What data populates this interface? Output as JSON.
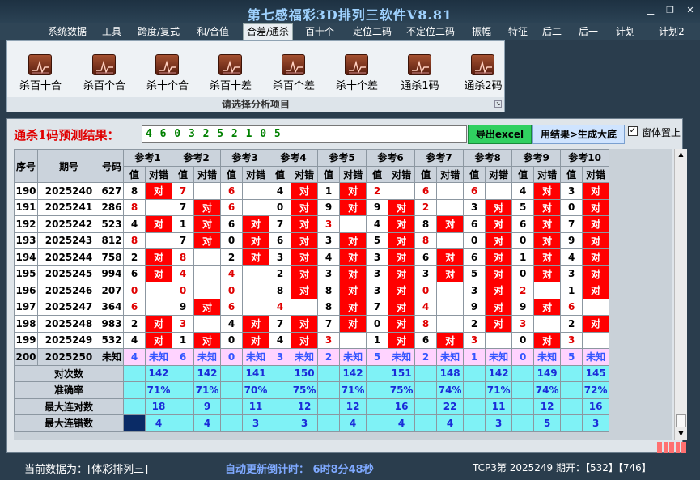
{
  "window": {
    "title": "第七感福彩3D排列三软件V8.81"
  },
  "menu": [
    "系统数据",
    "工具",
    "跨度/复式",
    "和/合值",
    "合差/通杀",
    "百十个",
    "定位二码",
    "不定位二码",
    "振幅",
    "特征",
    "后二",
    "后一",
    "计划",
    "计划2"
  ],
  "ribbon": {
    "buttons": [
      "杀百十合",
      "杀百个合",
      "杀十个合",
      "杀百十差",
      "杀百个差",
      "杀十个差",
      "通杀1码",
      "通杀2码"
    ],
    "caption": "请选择分析项目"
  },
  "prediction": {
    "label": "通杀1码预测结果：",
    "value": "4 6 0 3 2 5 2 1 0 5",
    "export_label": "导出excel",
    "generate_label": "用结果>生成大底",
    "on_top_label": "窗体置上"
  },
  "table": {
    "head_seq": "序号",
    "head_issue": "期号",
    "head_num": "号码",
    "ref_names": [
      "参考1",
      "参考2",
      "参考3",
      "参考4",
      "参考5",
      "参考6",
      "参考7",
      "参考8",
      "参考9",
      "参考10"
    ],
    "sub_val": "值",
    "sub_mark": "对错",
    "mark_text": "对",
    "rows": [
      {
        "seq": "190",
        "issue": "2025240",
        "num": "627",
        "vals": [
          "8",
          "7",
          "6",
          "4",
          "1",
          "2",
          "6",
          "6",
          "4",
          "3"
        ],
        "hits": [
          1,
          0,
          0,
          1,
          1,
          0,
          0,
          0,
          1,
          1
        ]
      },
      {
        "seq": "191",
        "issue": "2025241",
        "num": "286",
        "vals": [
          "8",
          "7",
          "6",
          "0",
          "9",
          "9",
          "2",
          "3",
          "5",
          "0"
        ],
        "hits": [
          0,
          1,
          0,
          1,
          1,
          1,
          0,
          1,
          1,
          1
        ]
      },
      {
        "seq": "192",
        "issue": "2025242",
        "num": "523",
        "vals": [
          "4",
          "1",
          "6",
          "7",
          "3",
          "4",
          "8",
          "6",
          "6",
          "7"
        ],
        "hits": [
          1,
          1,
          1,
          1,
          0,
          1,
          1,
          1,
          1,
          1
        ]
      },
      {
        "seq": "193",
        "issue": "2025243",
        "num": "812",
        "vals": [
          "8",
          "7",
          "0",
          "6",
          "3",
          "5",
          "8",
          "0",
          "0",
          "9"
        ],
        "hits": [
          0,
          1,
          1,
          1,
          1,
          1,
          0,
          1,
          1,
          1
        ]
      },
      {
        "seq": "194",
        "issue": "2025244",
        "num": "758",
        "vals": [
          "2",
          "8",
          "2",
          "3",
          "4",
          "3",
          "6",
          "6",
          "1",
          "4"
        ],
        "hits": [
          1,
          0,
          1,
          1,
          1,
          1,
          1,
          1,
          1,
          1
        ]
      },
      {
        "seq": "195",
        "issue": "2025245",
        "num": "994",
        "vals": [
          "6",
          "4",
          "4",
          "2",
          "3",
          "3",
          "3",
          "5",
          "0",
          "3"
        ],
        "hits": [
          1,
          0,
          0,
          1,
          1,
          1,
          1,
          1,
          1,
          1
        ]
      },
      {
        "seq": "196",
        "issue": "2025246",
        "num": "207",
        "vals": [
          "0",
          "0",
          "0",
          "8",
          "8",
          "3",
          "0",
          "3",
          "2",
          "1"
        ],
        "hits": [
          0,
          0,
          0,
          1,
          1,
          1,
          0,
          1,
          0,
          1
        ]
      },
      {
        "seq": "197",
        "issue": "2025247",
        "num": "364",
        "vals": [
          "6",
          "9",
          "6",
          "4",
          "8",
          "7",
          "4",
          "9",
          "9",
          "6"
        ],
        "hits": [
          0,
          1,
          0,
          0,
          1,
          1,
          0,
          1,
          1,
          0
        ]
      },
      {
        "seq": "198",
        "issue": "2025248",
        "num": "983",
        "vals": [
          "2",
          "3",
          "4",
          "7",
          "7",
          "0",
          "8",
          "2",
          "3",
          "2"
        ],
        "hits": [
          1,
          0,
          1,
          1,
          1,
          1,
          0,
          1,
          0,
          1
        ]
      },
      {
        "seq": "199",
        "issue": "2025249",
        "num": "532",
        "vals": [
          "4",
          "1",
          "0",
          "4",
          "3",
          "1",
          "6",
          "3",
          "0",
          "3"
        ],
        "hits": [
          1,
          1,
          1,
          1,
          0,
          1,
          1,
          0,
          1,
          0
        ]
      }
    ],
    "last_row": {
      "seq": "200",
      "issue": "2025250",
      "num": "未知",
      "vals": [
        "4",
        "6",
        "0",
        "3",
        "2",
        "5",
        "2",
        "1",
        "0",
        "5"
      ],
      "mark": "未知"
    },
    "summary": [
      {
        "label": "对次数",
        "values": [
          "142",
          "142",
          "141",
          "150",
          "142",
          "151",
          "148",
          "142",
          "149",
          "145"
        ]
      },
      {
        "label": "准确率",
        "values": [
          "71%",
          "71%",
          "70%",
          "75%",
          "71%",
          "75%",
          "74%",
          "71%",
          "74%",
          "72%"
        ]
      },
      {
        "label": "最大连对数",
        "values": [
          "18",
          "9",
          "11",
          "12",
          "12",
          "16",
          "22",
          "11",
          "12",
          "16"
        ]
      },
      {
        "label": "最大连错数",
        "values": [
          "4",
          "4",
          "3",
          "3",
          "4",
          "4",
          "4",
          "3",
          "5",
          "3"
        ]
      }
    ]
  },
  "status": {
    "source": "当前数据为：[体彩排列三]",
    "countdown": "自动更新倒计时：  6时8分48秒",
    "issue": "TCP3第  2025249  期开：【532】【746】"
  },
  "colors": {
    "hit": "#ff0000",
    "summary": "#7ff2f6",
    "pending_row": "#ffd3ff",
    "prediction_text": "#008000"
  }
}
